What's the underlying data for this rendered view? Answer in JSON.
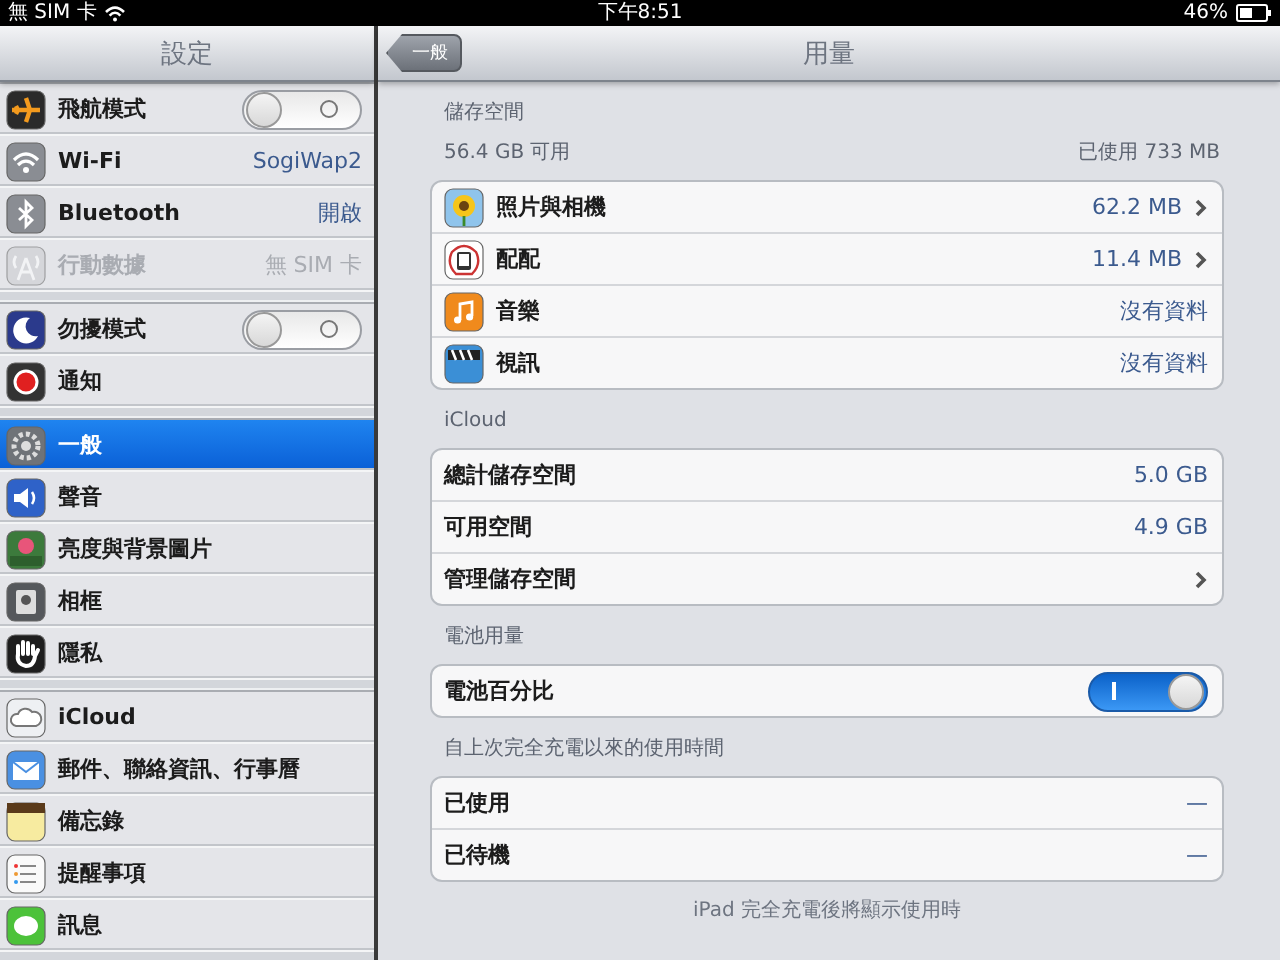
{
  "status_bar": {
    "carrier": "無 SIM 卡",
    "time": "下午8:51",
    "battery": "46%"
  },
  "sidebar": {
    "title": "設定",
    "groups": [
      {
        "items": [
          {
            "label": "飛航模式",
            "kind": "toggle",
            "on": false,
            "disabled": false,
            "selected": false
          },
          {
            "label": "Wi-Fi",
            "kind": "value",
            "value": "SogiWap2",
            "disabled": false,
            "selected": false
          },
          {
            "label": "Bluetooth",
            "kind": "value",
            "value": "開啟",
            "disabled": false,
            "selected": false
          },
          {
            "label": "行動數據",
            "kind": "value",
            "value": "無 SIM 卡",
            "disabled": true,
            "selected": false
          }
        ]
      },
      {
        "items": [
          {
            "label": "勿擾模式",
            "kind": "toggle",
            "on": false,
            "disabled": false,
            "selected": false
          },
          {
            "label": "通知",
            "kind": "plain",
            "disabled": false,
            "selected": false
          }
        ]
      },
      {
        "items": [
          {
            "label": "一般",
            "kind": "plain",
            "disabled": false,
            "selected": true
          },
          {
            "label": "聲音",
            "kind": "plain",
            "disabled": false,
            "selected": false
          },
          {
            "label": "亮度與背景圖片",
            "kind": "plain",
            "disabled": false,
            "selected": false
          },
          {
            "label": "相框",
            "kind": "plain",
            "disabled": false,
            "selected": false
          },
          {
            "label": "隱私",
            "kind": "plain",
            "disabled": false,
            "selected": false
          }
        ]
      },
      {
        "items": [
          {
            "label": "iCloud",
            "kind": "plain",
            "disabled": false,
            "selected": false
          },
          {
            "label": "郵件、聯絡資訊、行事曆",
            "kind": "plain",
            "disabled": false,
            "selected": false
          },
          {
            "label": "備忘錄",
            "kind": "plain",
            "disabled": false,
            "selected": false
          },
          {
            "label": "提醒事項",
            "kind": "plain",
            "disabled": false,
            "selected": false
          },
          {
            "label": "訊息",
            "kind": "plain",
            "disabled": false,
            "selected": false
          }
        ]
      }
    ]
  },
  "detail": {
    "back_button": "一般",
    "title": "用量",
    "sections": [
      {
        "header": "儲存空間",
        "subheader_left": "56.4 GB 可用",
        "subheader_right": "已使用 733 MB",
        "rows": [
          {
            "label": "照片與相機",
            "kind": "value",
            "value": "62.2 MB",
            "chevron": true
          },
          {
            "label": "配配",
            "kind": "value",
            "value": "11.4 MB",
            "chevron": true
          },
          {
            "label": "音樂",
            "kind": "value",
            "value": "沒有資料",
            "chevron": false
          },
          {
            "label": "視訊",
            "kind": "value",
            "value": "沒有資料",
            "chevron": false
          }
        ]
      },
      {
        "header": "iCloud",
        "rows": [
          {
            "label": "總計儲存空間",
            "kind": "value",
            "value": "5.0 GB",
            "chevron": false
          },
          {
            "label": "可用空間",
            "kind": "value",
            "value": "4.9 GB",
            "chevron": false
          },
          {
            "label": "管理儲存空間",
            "kind": "value",
            "chevron": true
          }
        ]
      },
      {
        "header": "電池用量",
        "rows": [
          {
            "label": "電池百分比",
            "kind": "toggle",
            "on": true
          }
        ]
      },
      {
        "header": "自上次完全充電以來的使用時間",
        "rows": [
          {
            "label": "已使用",
            "kind": "value",
            "value": "—",
            "chevron": false
          },
          {
            "label": "已待機",
            "kind": "value",
            "value": "—",
            "chevron": false
          }
        ]
      }
    ],
    "footer": "iPad 完全充電後將顯示使用時"
  }
}
